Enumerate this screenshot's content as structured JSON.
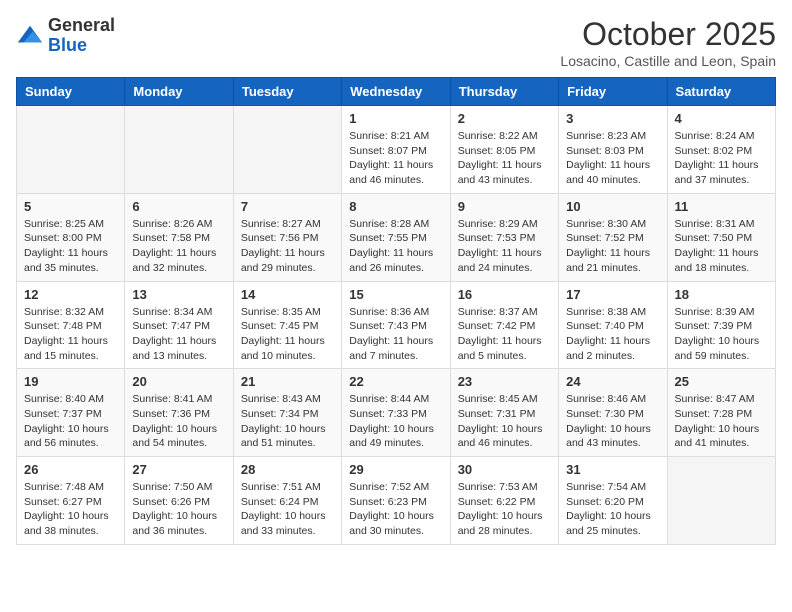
{
  "header": {
    "logo_general": "General",
    "logo_blue": "Blue",
    "month_title": "October 2025",
    "location": "Losacino, Castille and Leon, Spain"
  },
  "weekdays": [
    "Sunday",
    "Monday",
    "Tuesday",
    "Wednesday",
    "Thursday",
    "Friday",
    "Saturday"
  ],
  "weeks": [
    [
      {
        "day": "",
        "info": ""
      },
      {
        "day": "",
        "info": ""
      },
      {
        "day": "",
        "info": ""
      },
      {
        "day": "1",
        "info": "Sunrise: 8:21 AM\nSunset: 8:07 PM\nDaylight: 11 hours and 46 minutes."
      },
      {
        "day": "2",
        "info": "Sunrise: 8:22 AM\nSunset: 8:05 PM\nDaylight: 11 hours and 43 minutes."
      },
      {
        "day": "3",
        "info": "Sunrise: 8:23 AM\nSunset: 8:03 PM\nDaylight: 11 hours and 40 minutes."
      },
      {
        "day": "4",
        "info": "Sunrise: 8:24 AM\nSunset: 8:02 PM\nDaylight: 11 hours and 37 minutes."
      }
    ],
    [
      {
        "day": "5",
        "info": "Sunrise: 8:25 AM\nSunset: 8:00 PM\nDaylight: 11 hours and 35 minutes."
      },
      {
        "day": "6",
        "info": "Sunrise: 8:26 AM\nSunset: 7:58 PM\nDaylight: 11 hours and 32 minutes."
      },
      {
        "day": "7",
        "info": "Sunrise: 8:27 AM\nSunset: 7:56 PM\nDaylight: 11 hours and 29 minutes."
      },
      {
        "day": "8",
        "info": "Sunrise: 8:28 AM\nSunset: 7:55 PM\nDaylight: 11 hours and 26 minutes."
      },
      {
        "day": "9",
        "info": "Sunrise: 8:29 AM\nSunset: 7:53 PM\nDaylight: 11 hours and 24 minutes."
      },
      {
        "day": "10",
        "info": "Sunrise: 8:30 AM\nSunset: 7:52 PM\nDaylight: 11 hours and 21 minutes."
      },
      {
        "day": "11",
        "info": "Sunrise: 8:31 AM\nSunset: 7:50 PM\nDaylight: 11 hours and 18 minutes."
      }
    ],
    [
      {
        "day": "12",
        "info": "Sunrise: 8:32 AM\nSunset: 7:48 PM\nDaylight: 11 hours and 15 minutes."
      },
      {
        "day": "13",
        "info": "Sunrise: 8:34 AM\nSunset: 7:47 PM\nDaylight: 11 hours and 13 minutes."
      },
      {
        "day": "14",
        "info": "Sunrise: 8:35 AM\nSunset: 7:45 PM\nDaylight: 11 hours and 10 minutes."
      },
      {
        "day": "15",
        "info": "Sunrise: 8:36 AM\nSunset: 7:43 PM\nDaylight: 11 hours and 7 minutes."
      },
      {
        "day": "16",
        "info": "Sunrise: 8:37 AM\nSunset: 7:42 PM\nDaylight: 11 hours and 5 minutes."
      },
      {
        "day": "17",
        "info": "Sunrise: 8:38 AM\nSunset: 7:40 PM\nDaylight: 11 hours and 2 minutes."
      },
      {
        "day": "18",
        "info": "Sunrise: 8:39 AM\nSunset: 7:39 PM\nDaylight: 10 hours and 59 minutes."
      }
    ],
    [
      {
        "day": "19",
        "info": "Sunrise: 8:40 AM\nSunset: 7:37 PM\nDaylight: 10 hours and 56 minutes."
      },
      {
        "day": "20",
        "info": "Sunrise: 8:41 AM\nSunset: 7:36 PM\nDaylight: 10 hours and 54 minutes."
      },
      {
        "day": "21",
        "info": "Sunrise: 8:43 AM\nSunset: 7:34 PM\nDaylight: 10 hours and 51 minutes."
      },
      {
        "day": "22",
        "info": "Sunrise: 8:44 AM\nSunset: 7:33 PM\nDaylight: 10 hours and 49 minutes."
      },
      {
        "day": "23",
        "info": "Sunrise: 8:45 AM\nSunset: 7:31 PM\nDaylight: 10 hours and 46 minutes."
      },
      {
        "day": "24",
        "info": "Sunrise: 8:46 AM\nSunset: 7:30 PM\nDaylight: 10 hours and 43 minutes."
      },
      {
        "day": "25",
        "info": "Sunrise: 8:47 AM\nSunset: 7:28 PM\nDaylight: 10 hours and 41 minutes."
      }
    ],
    [
      {
        "day": "26",
        "info": "Sunrise: 7:48 AM\nSunset: 6:27 PM\nDaylight: 10 hours and 38 minutes."
      },
      {
        "day": "27",
        "info": "Sunrise: 7:50 AM\nSunset: 6:26 PM\nDaylight: 10 hours and 36 minutes."
      },
      {
        "day": "28",
        "info": "Sunrise: 7:51 AM\nSunset: 6:24 PM\nDaylight: 10 hours and 33 minutes."
      },
      {
        "day": "29",
        "info": "Sunrise: 7:52 AM\nSunset: 6:23 PM\nDaylight: 10 hours and 30 minutes."
      },
      {
        "day": "30",
        "info": "Sunrise: 7:53 AM\nSunset: 6:22 PM\nDaylight: 10 hours and 28 minutes."
      },
      {
        "day": "31",
        "info": "Sunrise: 7:54 AM\nSunset: 6:20 PM\nDaylight: 10 hours and 25 minutes."
      },
      {
        "day": "",
        "info": ""
      }
    ]
  ]
}
